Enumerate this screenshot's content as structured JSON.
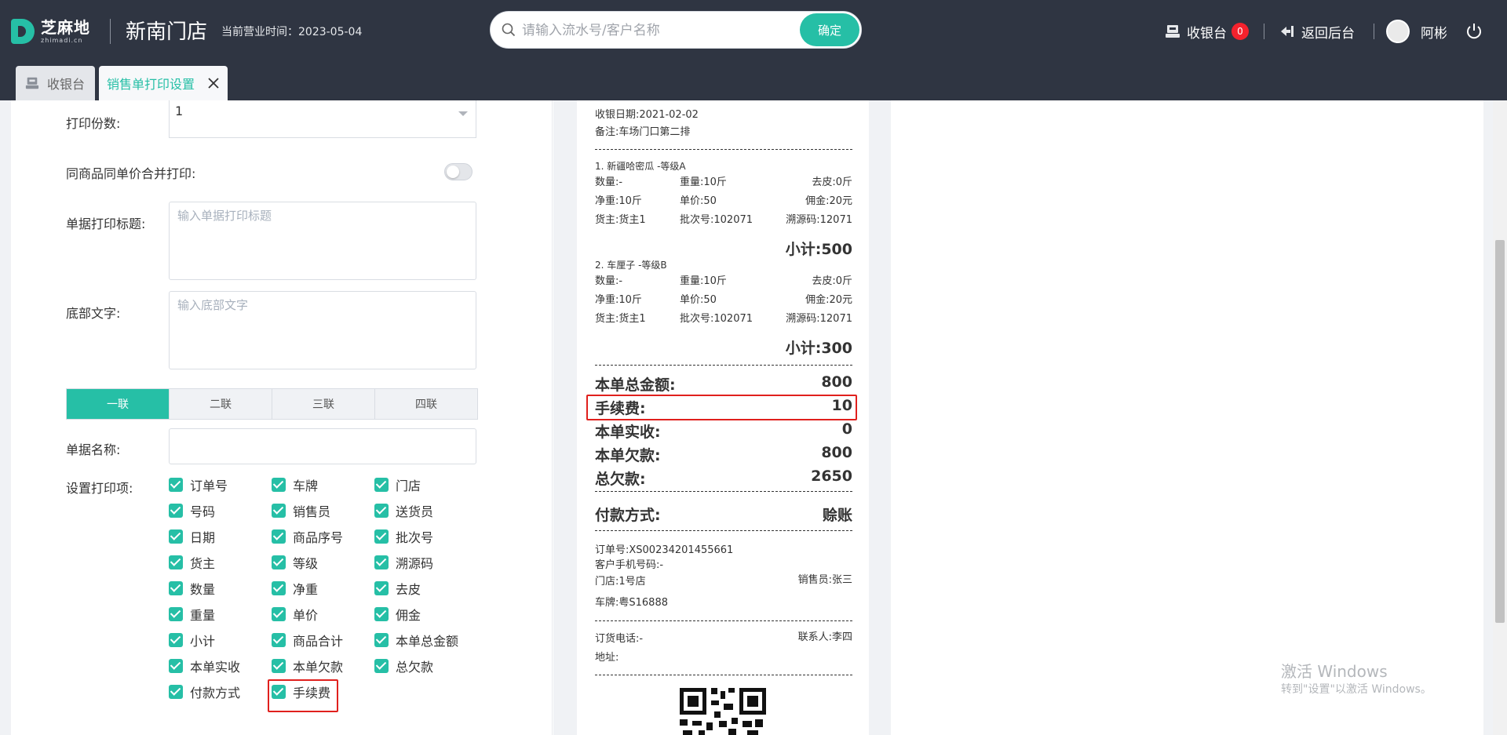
{
  "header": {
    "logo_cn": "芝麻地",
    "logo_en": "zhimadi.cn",
    "store_name": "新南门店",
    "business_time": "当前营业时间：2023-05-04",
    "search_placeholder": "请输入流水号/客户名称",
    "search_button": "确定",
    "cashier_label": "收银台",
    "cashier_badge": "0",
    "back_label": "返回后台",
    "user_name": "阿彬"
  },
  "tabs": [
    {
      "label": "收银台",
      "active": false
    },
    {
      "label": "销售单打印设置",
      "active": true
    }
  ],
  "settings": {
    "copies_label": "打印份数:",
    "copies_value": "1",
    "merge_label": "同商品同单价合并打印:",
    "merge_enabled": false,
    "title_label": "单据打印标题:",
    "title_placeholder": "输入单据打印标题",
    "footer_label": "底部文字:",
    "footer_placeholder": "输入底部文字",
    "copies_tabs": [
      "一联",
      "二联",
      "三联",
      "四联"
    ],
    "active_copy_tab": "一联",
    "doc_name_label": "单据名称:",
    "doc_name_value": "",
    "print_items_label": "设置打印项:",
    "print_items": [
      "订单号",
      "车牌",
      "门店",
      "号码",
      "销售员",
      "送货员",
      "日期",
      "商品序号",
      "批次号",
      "货主",
      "等级",
      "溯源码",
      "数量",
      "净重",
      "去皮",
      "重量",
      "单价",
      "佣金",
      "小计",
      "商品合计",
      "本单总金额",
      "本单实收",
      "本单欠款",
      "总欠款",
      "付款方式",
      "手续费"
    ],
    "highlighted_item": "手续费"
  },
  "receipt": {
    "date": "收银日期:2021-02-02",
    "remark": "备注:车场门口第二排",
    "items": [
      {
        "title": "1. 新疆哈密瓜 -等级A",
        "qty": "数量:-",
        "weight": "重量:10斤",
        "tare": "去皮:0斤",
        "net": "净重:10斤",
        "price": "单价:50",
        "commission": "佣金:20元",
        "owner": "货主:货主1",
        "batch": "批次号:102071",
        "trace": "溯源码:12071",
        "subtotal": "小计:500"
      },
      {
        "title": "2. 车厘子 -等级B",
        "qty": "数量:-",
        "weight": "重量:10斤",
        "tare": "去皮:0斤",
        "net": "净重:10斤",
        "price": "单价:50",
        "commission": "佣金:20元",
        "owner": "货主:货主1",
        "batch": "批次号:102071",
        "trace": "溯源码:12071",
        "subtotal": "小计:300"
      }
    ],
    "totals": [
      {
        "label": "本单总金额:",
        "value": "800"
      },
      {
        "label": "手续费:",
        "value": "10"
      },
      {
        "label": "本单实收:",
        "value": "0"
      },
      {
        "label": "本单欠款:",
        "value": "800"
      },
      {
        "label": "总欠款:",
        "value": "2650"
      }
    ],
    "payment_label": "付款方式:",
    "payment_value": "赊账",
    "order_no": "订单号:XS00234201455661",
    "customer_phone": "客户手机号码:-",
    "store": "门店:1号店",
    "salesperson": "销售员:张三",
    "plate": "车牌:粤S16888",
    "order_phone": "订货电话:-",
    "contact": "联系人:李四",
    "address": "地址:"
  },
  "watermark": {
    "line1": "激活 Windows",
    "line2": "转到\"设置\"以激活 Windows。"
  },
  "colors": {
    "header_bg": "#2f3542",
    "accent": "#26bfa6",
    "highlight": "#e0201d",
    "badge": "#f5222d"
  }
}
